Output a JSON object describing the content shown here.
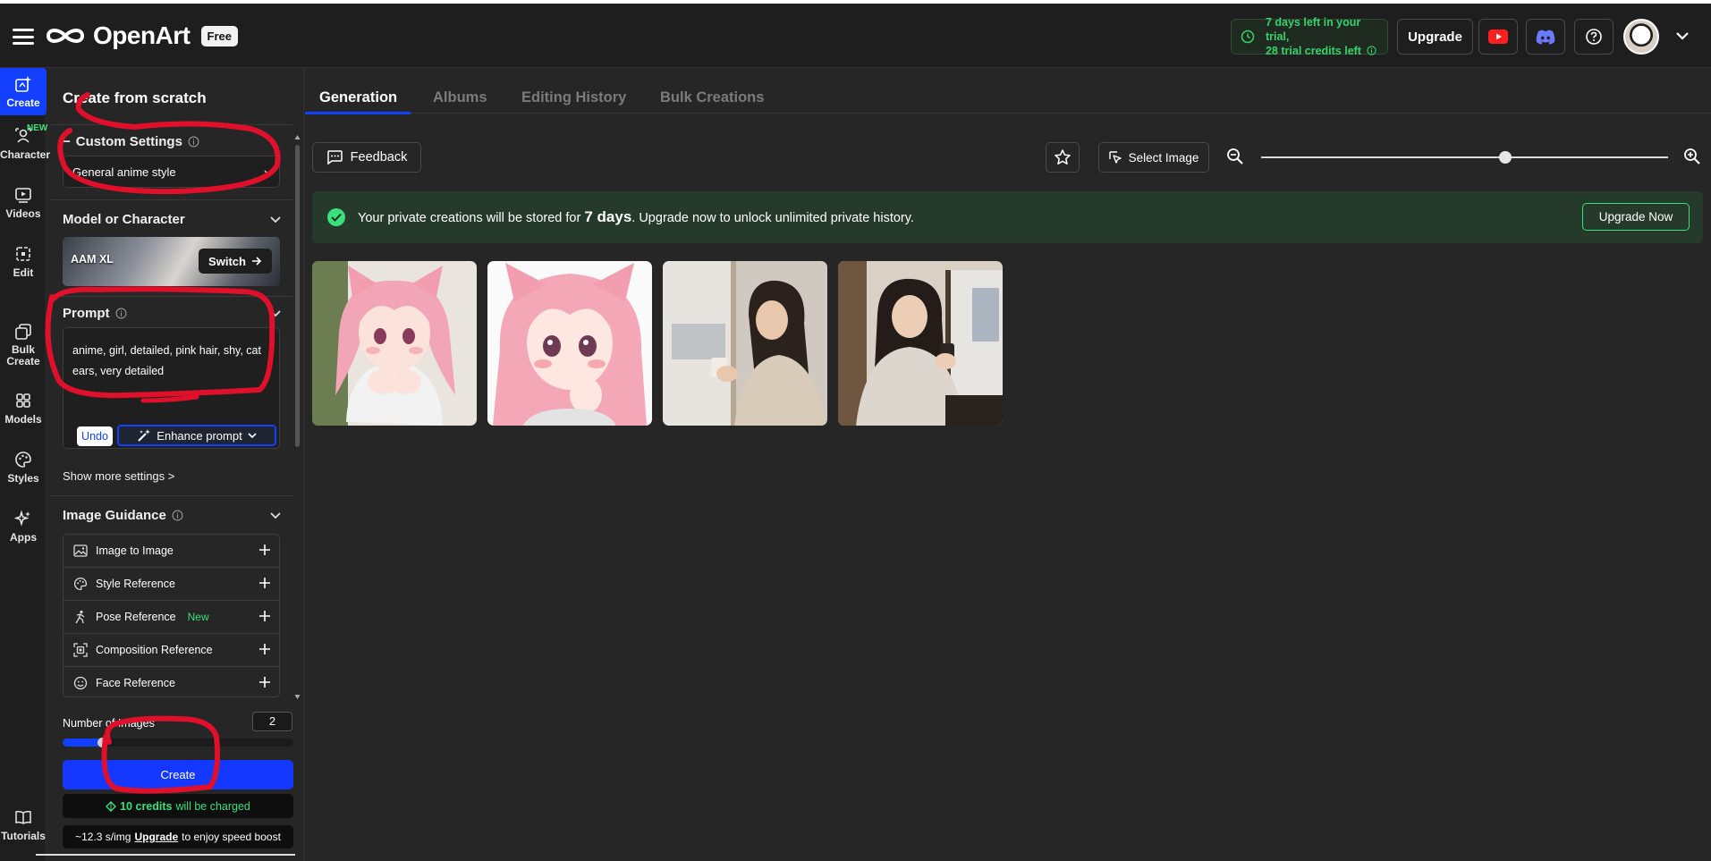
{
  "topbar": {
    "brand": "OpenArt",
    "plan_badge": "Free",
    "trial_line1": "7 days left in your trial,",
    "trial_line2": "28 trial credits left",
    "upgrade_label": "Upgrade"
  },
  "rail": {
    "items": [
      {
        "label": "Create",
        "icon": "create-icon"
      },
      {
        "label": "Character",
        "icon": "character-icon",
        "badge": "NEW"
      },
      {
        "label": "Videos",
        "icon": "video-icon"
      },
      {
        "label": "Edit",
        "icon": "edit-icon"
      },
      {
        "label": "Bulk Create",
        "label_line1": "Bulk",
        "label_line2": "Create",
        "icon": "bulk-create-icon"
      },
      {
        "label": "Models",
        "icon": "models-icon"
      },
      {
        "label": "Styles",
        "icon": "palette-icon"
      },
      {
        "label": "Apps",
        "icon": "apps-icon"
      }
    ],
    "tutorials": "Tutorials"
  },
  "panel": {
    "title": "Create from scratch",
    "custom_settings": {
      "title": "Custom Settings",
      "prefix": "−",
      "selected": "General anime style"
    },
    "model": {
      "title": "Model or Character",
      "name": "AAM XL",
      "switch_label": "Switch"
    },
    "prompt": {
      "title": "Prompt",
      "value": "anime, girl, detailed, pink hair, shy, cat ears, very detailed",
      "undo_label": "Undo",
      "enhance_label": "Enhance prompt"
    },
    "show_more": "Show more settings >",
    "image_guidance": {
      "title": "Image Guidance",
      "items": [
        {
          "label": "Image to Image",
          "icon": "image-icon"
        },
        {
          "label": "Style Reference",
          "icon": "palette-icon"
        },
        {
          "label": "Pose Reference",
          "icon": "pose-icon",
          "badge": "New"
        },
        {
          "label": "Composition Reference",
          "icon": "composition-icon"
        },
        {
          "label": "Face Reference",
          "icon": "face-icon"
        }
      ]
    },
    "num_images": {
      "label": "Number of Images",
      "value": "2",
      "fraction": 0.15
    },
    "create_label": "Create",
    "credits": {
      "amount": "10 credits",
      "suffix": "will be charged"
    },
    "speed": {
      "rate": "~12.3 s/img",
      "link": "Upgrade",
      "suffix": "to enjoy speed boost"
    }
  },
  "main": {
    "tabs": [
      {
        "label": "Generation",
        "active": true
      },
      {
        "label": "Albums",
        "active": false
      },
      {
        "label": "Editing History",
        "active": false
      },
      {
        "label": "Bulk Creations",
        "active": false
      }
    ],
    "feedback_label": "Feedback",
    "select_image_label": "Select Image",
    "zoom_fraction": 0.6,
    "banner": {
      "part1": "Your private creations will be stored for ",
      "highlight": "7 days",
      "part2": ". Upgrade now to unlock unlimited private history.",
      "button": "Upgrade Now"
    },
    "images": [
      {
        "subject": "pink-haired anime girl with cat ears"
      },
      {
        "subject": "pink-haired anime girl with cat ears close-up"
      },
      {
        "subject": "woman holding cup by window"
      },
      {
        "subject": "woman with coffee cup by window"
      }
    ]
  },
  "colors": {
    "accent": "#1340ff",
    "success": "#3ae07a",
    "annotation": "#e0102a",
    "background": "#262626"
  }
}
